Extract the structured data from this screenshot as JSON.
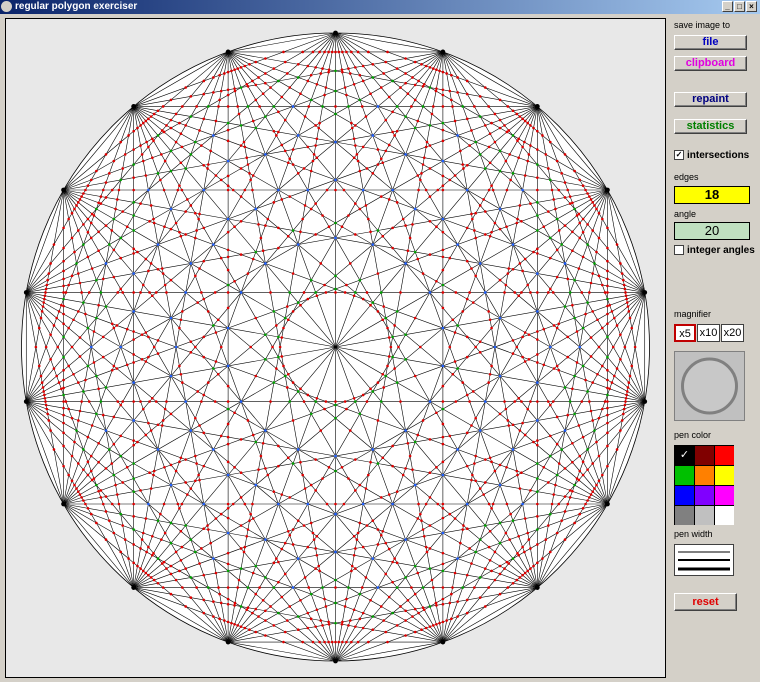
{
  "window": {
    "title": "regular polygon exerciser",
    "controls": [
      "_",
      "□",
      "×"
    ]
  },
  "panel": {
    "save_label": "save image to",
    "file_label": "file",
    "clipboard_label": "clipboard",
    "repaint_label": "repaint",
    "statistics_label": "statistics",
    "intersections_label": "intersections",
    "intersections_checked": true,
    "edges_label": "edges",
    "edges_value": "18",
    "angle_label": "angle",
    "angle_value": "20",
    "integer_angles_label": "integer angles",
    "integer_angles_checked": false,
    "magnifier_label": "magnifier",
    "magnifier_options": [
      "x5",
      "x10",
      "x20"
    ],
    "magnifier_selected": "x5",
    "pen_color_label": "pen color",
    "pen_colors": [
      "#000000",
      "#800000",
      "#ff0000",
      "#00c000",
      "#ff8000",
      "#ffff00",
      "#0000ff",
      "#8000ff",
      "#ff00ff",
      "#808080",
      "#c0c0c0",
      "#ffffff"
    ],
    "pen_color_selected": "#000000",
    "pen_width_label": "pen width",
    "reset_label": "reset"
  },
  "drawing": {
    "vertices": 18,
    "colors": {
      "line": "#000000",
      "red": "#e00000",
      "green": "#00a000",
      "blue": "#2060ff"
    }
  }
}
